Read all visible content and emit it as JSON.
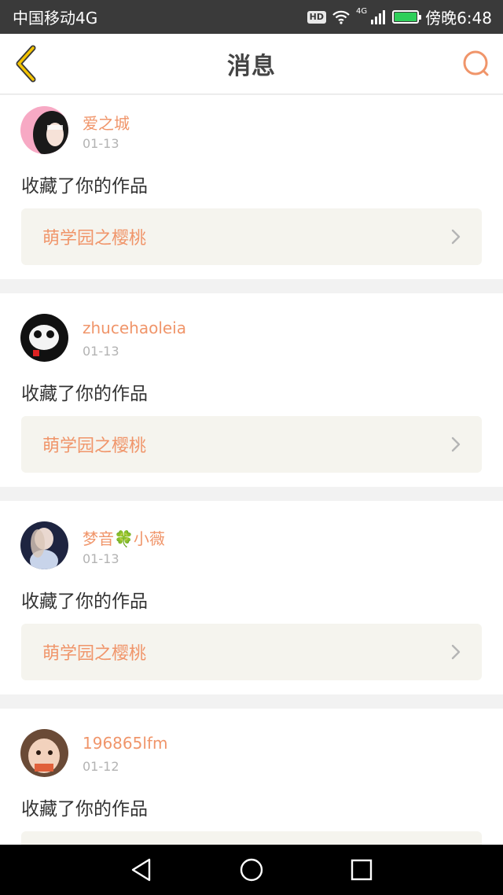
{
  "status_bar": {
    "carrier": "中国移动4G",
    "hd": "HD",
    "network": "4G",
    "time": "傍晚6:48"
  },
  "header": {
    "title": "消息",
    "back_icon": "chevron-left-icon",
    "search_icon": "search-icon"
  },
  "colors": {
    "accent": "#f0956a",
    "icon_yellow": "#f5c400",
    "card_link_bg": "#f5f4ee"
  },
  "messages": [
    {
      "username": "爱之城",
      "date": "01-13",
      "message": "收藏了你的作品",
      "work_title": "萌学园之樱桃"
    },
    {
      "username": "zhucehaoleia",
      "date": "01-13",
      "message": "收藏了你的作品",
      "work_title": "萌学园之樱桃"
    },
    {
      "username": "梦音🍀小薇",
      "date": "01-13",
      "message": "收藏了你的作品",
      "work_title": "萌学园之樱桃"
    },
    {
      "username": "196865lfm",
      "date": "01-12",
      "message": "收藏了你的作品",
      "work_title": ""
    }
  ],
  "nav": {
    "back_icon": "triangle-back-icon",
    "home_icon": "circle-home-icon",
    "recents_icon": "square-recents-icon"
  }
}
